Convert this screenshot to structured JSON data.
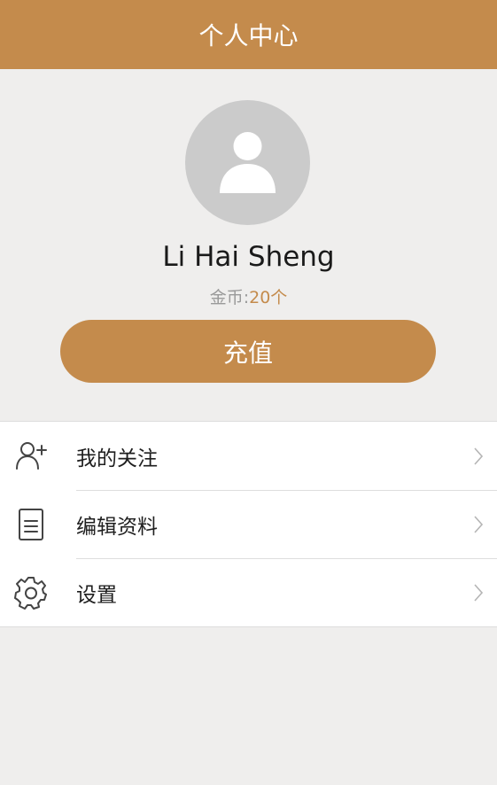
{
  "header": {
    "title": "个人中心"
  },
  "profile": {
    "avatar_icon": "user-avatar-icon",
    "username": "Li Hai Sheng",
    "coins_label": "金币:",
    "coins_value": "20个",
    "recharge_label": "充值"
  },
  "menu": {
    "items": [
      {
        "label": "我的关注",
        "icon": "follow-user-icon"
      },
      {
        "label": "编辑资料",
        "icon": "document-icon"
      },
      {
        "label": "设置",
        "icon": "gear-icon"
      }
    ]
  },
  "colors": {
    "accent": "#c48b4c",
    "background": "#efeeed",
    "avatar_bg": "#cbcbcb"
  }
}
